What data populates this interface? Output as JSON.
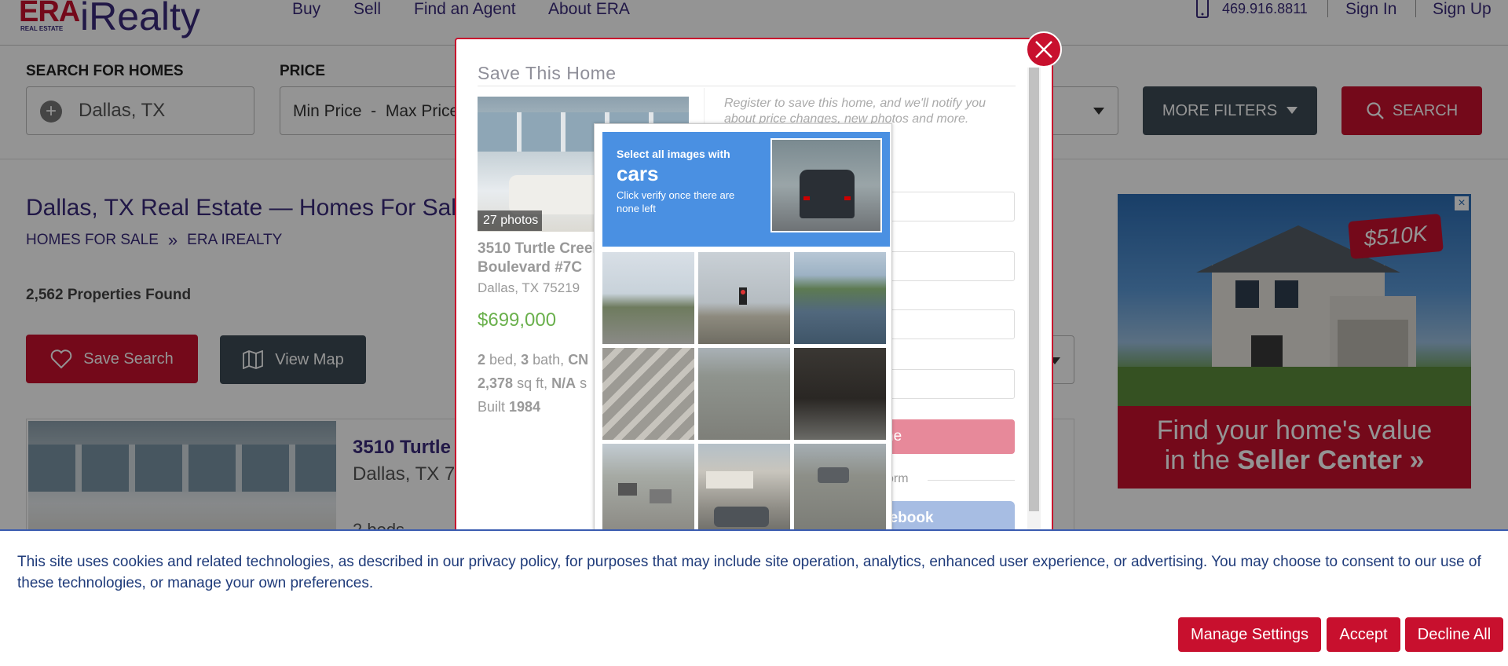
{
  "header": {
    "logo_era": "ERA",
    "logo_sub": "REAL ESTATE",
    "logo_brand": "iRealty",
    "nav": [
      "Buy",
      "Sell",
      "Find an Agent",
      "About ERA"
    ],
    "phone": "469.916.8811",
    "sign_in": "Sign In",
    "sign_up": "Sign Up"
  },
  "search": {
    "label_homes": "SEARCH FOR HOMES",
    "location_value": "Dallas, TX",
    "label_price": "PRICE",
    "price_value": "Min Price  -  Max Price",
    "more_filters": "MORE FILTERS",
    "search_button": "SEARCH"
  },
  "main": {
    "title": "Dallas, TX Real Estate — Homes For Sale",
    "breadcrumb": [
      "HOMES FOR SALE",
      "ERA IREALTY"
    ],
    "breadcrumb_sep": "»",
    "found": "2,562 Properties Found",
    "save_search": "Save Search",
    "view_map": "View Map",
    "listing": {
      "address": "3510 Turtle",
      "city": "Dallas, TX 7",
      "beds": "2 beds"
    }
  },
  "modal": {
    "title": "Save This Home",
    "photos_badge": "27 photos",
    "address_line1": "3510 Turtle Creek",
    "address_line2": "Boulevard #7C",
    "city": "Dallas, TX 75219",
    "price": "$699,000",
    "beds": "2",
    "beds_label": "bed,",
    "baths": "3",
    "baths_label": "bath,",
    "type": "CN",
    "sqft": "2,378",
    "sqft_label": "sq ft,",
    "lot": "N/A",
    "lot_label": "s",
    "built_label": "Built",
    "built": "1984",
    "register_text": "Register to save this home, and we'll notify you about price changes, new photos and more.",
    "email_placeholder": "m",
    "submit_partial": "ne",
    "or_form_partial": "orm",
    "facebook_partial": "cebook"
  },
  "captcha": {
    "instruction_small": "Select all images with",
    "target": "cars",
    "instruction_sub": "Click verify once there are none left",
    "tile_scenes": [
      "palm-trees",
      "traffic-light",
      "harbor-boats",
      "crosswalk",
      "road",
      "dark-overpass",
      "street-cars",
      "storefront-cars",
      "parking-lot"
    ]
  },
  "ad": {
    "price_tag": "$510K",
    "line1": "Find your home's value",
    "line2_prefix": "in the ",
    "line2_bold": "Seller Center »"
  },
  "cookie": {
    "text": "This site uses cookies and related technologies, as described in our privacy policy, for purposes that may include site operation, analytics, enhanced user experience, or advertising. You may choose to consent to our use of these technologies, or manage your own preferences.",
    "manage": "Manage Settings",
    "accept": "Accept",
    "decline": "Decline All"
  },
  "colors": {
    "brand_red": "#c8102e",
    "brand_purple": "#3a2a7a",
    "price_green": "#6ab04c",
    "captcha_blue": "#4a90e2"
  }
}
